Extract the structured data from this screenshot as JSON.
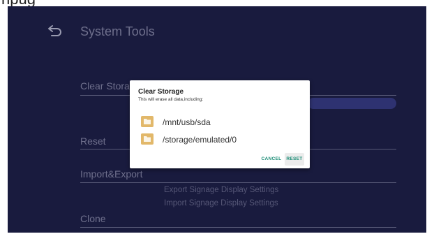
{
  "top_strip": {
    "text": "npug"
  },
  "header": {
    "title": "System Tools",
    "back_icon": "back-arrow-icon"
  },
  "sections": {
    "clear_storage": "Clear Storage",
    "reset": "Reset",
    "import_export": "Import&Export",
    "clone": "Clone"
  },
  "import_export_items": [
    "Export Signage Display Settings",
    "Import Signage Display Settings"
  ],
  "dialog": {
    "title": "Clear Storage",
    "message": "This will erase all data,including:",
    "paths": [
      {
        "icon": "folder-icon",
        "label": "/mnt/usb/sda"
      },
      {
        "icon": "folder-icon",
        "label": "/storage/emulated/0"
      }
    ],
    "cancel_label": "CANCEL",
    "reset_label": "RESET"
  },
  "colors": {
    "screen_bg": "#1e2048",
    "muted_text": "#8f91b0",
    "accent_pill": "#3a3f8c",
    "dialog_button": "#1a8c75",
    "folder": "#e2b86a"
  }
}
